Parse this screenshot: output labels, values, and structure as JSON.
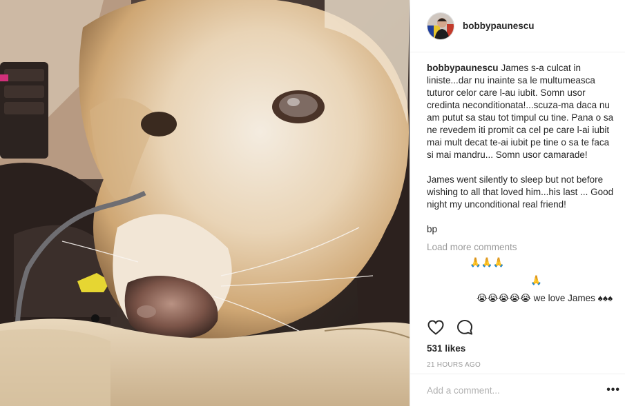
{
  "post": {
    "username": "bobbypaunescu",
    "caption": {
      "username": "bobbypaunescu",
      "text": "James s-a culcat in liniste...dar nu inainte sa le multumeasca tuturor celor care l-au iubit. Somn usor credinta neconditionata!...scuza-ma daca nu am putut sa stau tot timpul cu tine. Pana o sa ne revedem iti promit ca cel pe care l-ai iubit mai mult decat te-ai iubit pe tine o sa te faca si mai mandru... Somn usor camarade!\n\nJames went silently to sleep but not before wishing to all that loved him...his last ... Good night my unconditional real friend!\n\nbp"
    },
    "load_more_label": "Load more comments",
    "comment_lines": [
      "🙏🙏🙏",
      "🙏",
      "😭😭😭😭😭 we love James ♠♠♠"
    ],
    "likes": "531 likes",
    "time": "21 HOURS AGO",
    "add_comment_placeholder": "Add a comment...",
    "more_label": "•••"
  },
  "icons": {
    "like": "heart-outline-icon",
    "comment": "speech-bubble-icon",
    "more": "ellipsis-icon"
  }
}
